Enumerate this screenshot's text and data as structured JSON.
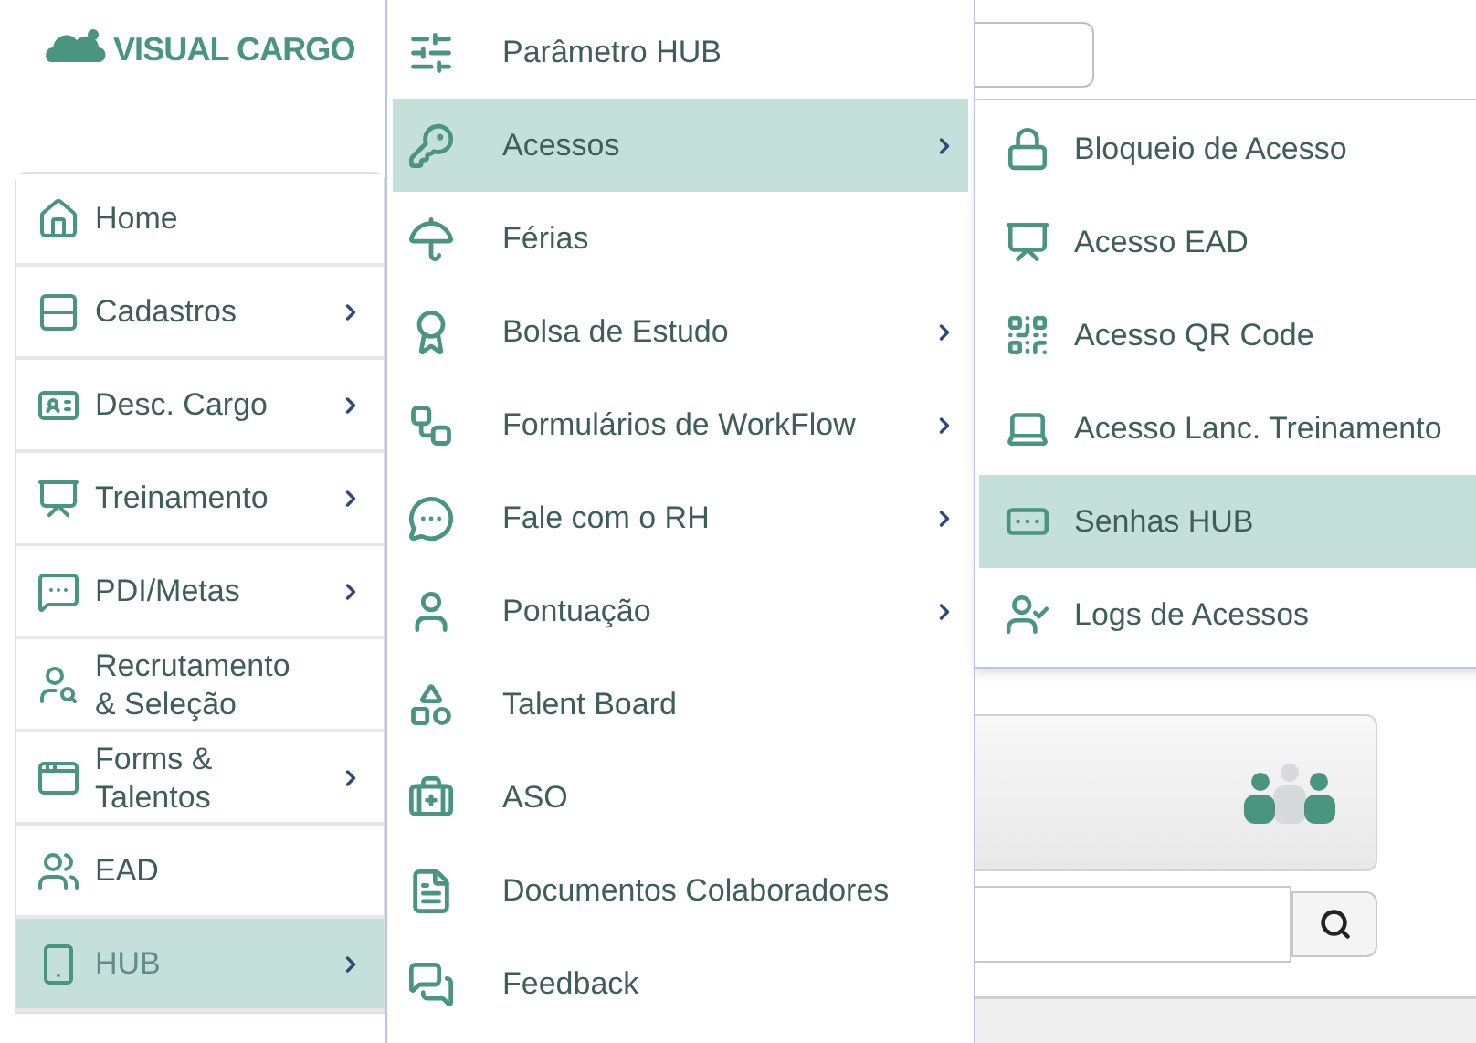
{
  "logo": {
    "text": "VISUAL CARGO"
  },
  "sidebar": {
    "items": [
      {
        "label": "Home",
        "has_submenu": false,
        "selected": false
      },
      {
        "label": "Cadastros",
        "has_submenu": true,
        "selected": false
      },
      {
        "label": "Desc. Cargo",
        "has_submenu": true,
        "selected": false
      },
      {
        "label": "Treinamento",
        "has_submenu": true,
        "selected": false
      },
      {
        "label": "PDI/Metas",
        "has_submenu": true,
        "selected": false
      },
      {
        "label": "Recrutamento\n& Seleção",
        "has_submenu": false,
        "selected": false
      },
      {
        "label": "Forms &\nTalentos",
        "has_submenu": true,
        "selected": false
      },
      {
        "label": "EAD",
        "has_submenu": false,
        "selected": false
      },
      {
        "label": "HUB",
        "has_submenu": true,
        "selected": true
      }
    ]
  },
  "submenu": {
    "items": [
      {
        "label": "Parâmetro HUB",
        "has_submenu": false,
        "selected": false
      },
      {
        "label": "Acessos",
        "has_submenu": true,
        "selected": true
      },
      {
        "label": "Férias",
        "has_submenu": false,
        "selected": false
      },
      {
        "label": "Bolsa de Estudo",
        "has_submenu": true,
        "selected": false
      },
      {
        "label": "Formulários de WorkFlow",
        "has_submenu": true,
        "selected": false
      },
      {
        "label": "Fale com o RH",
        "has_submenu": true,
        "selected": false
      },
      {
        "label": "Pontuação",
        "has_submenu": true,
        "selected": false
      },
      {
        "label": "Talent Board",
        "has_submenu": false,
        "selected": false
      },
      {
        "label": "ASO",
        "has_submenu": false,
        "selected": false
      },
      {
        "label": "Documentos Colaboradores",
        "has_submenu": false,
        "selected": false
      },
      {
        "label": "Feedback",
        "has_submenu": false,
        "selected": false
      }
    ]
  },
  "submenu_2": {
    "items": [
      {
        "label": "Bloqueio de Acesso",
        "selected": false
      },
      {
        "label": "Acesso EAD",
        "selected": false
      },
      {
        "label": "Acesso QR Code",
        "selected": false
      },
      {
        "label": "Acesso Lanc. Treinamento",
        "selected": false
      },
      {
        "label": "Senhas HUB",
        "selected": true
      },
      {
        "label": "Logs de Acessos",
        "selected": false
      }
    ]
  }
}
